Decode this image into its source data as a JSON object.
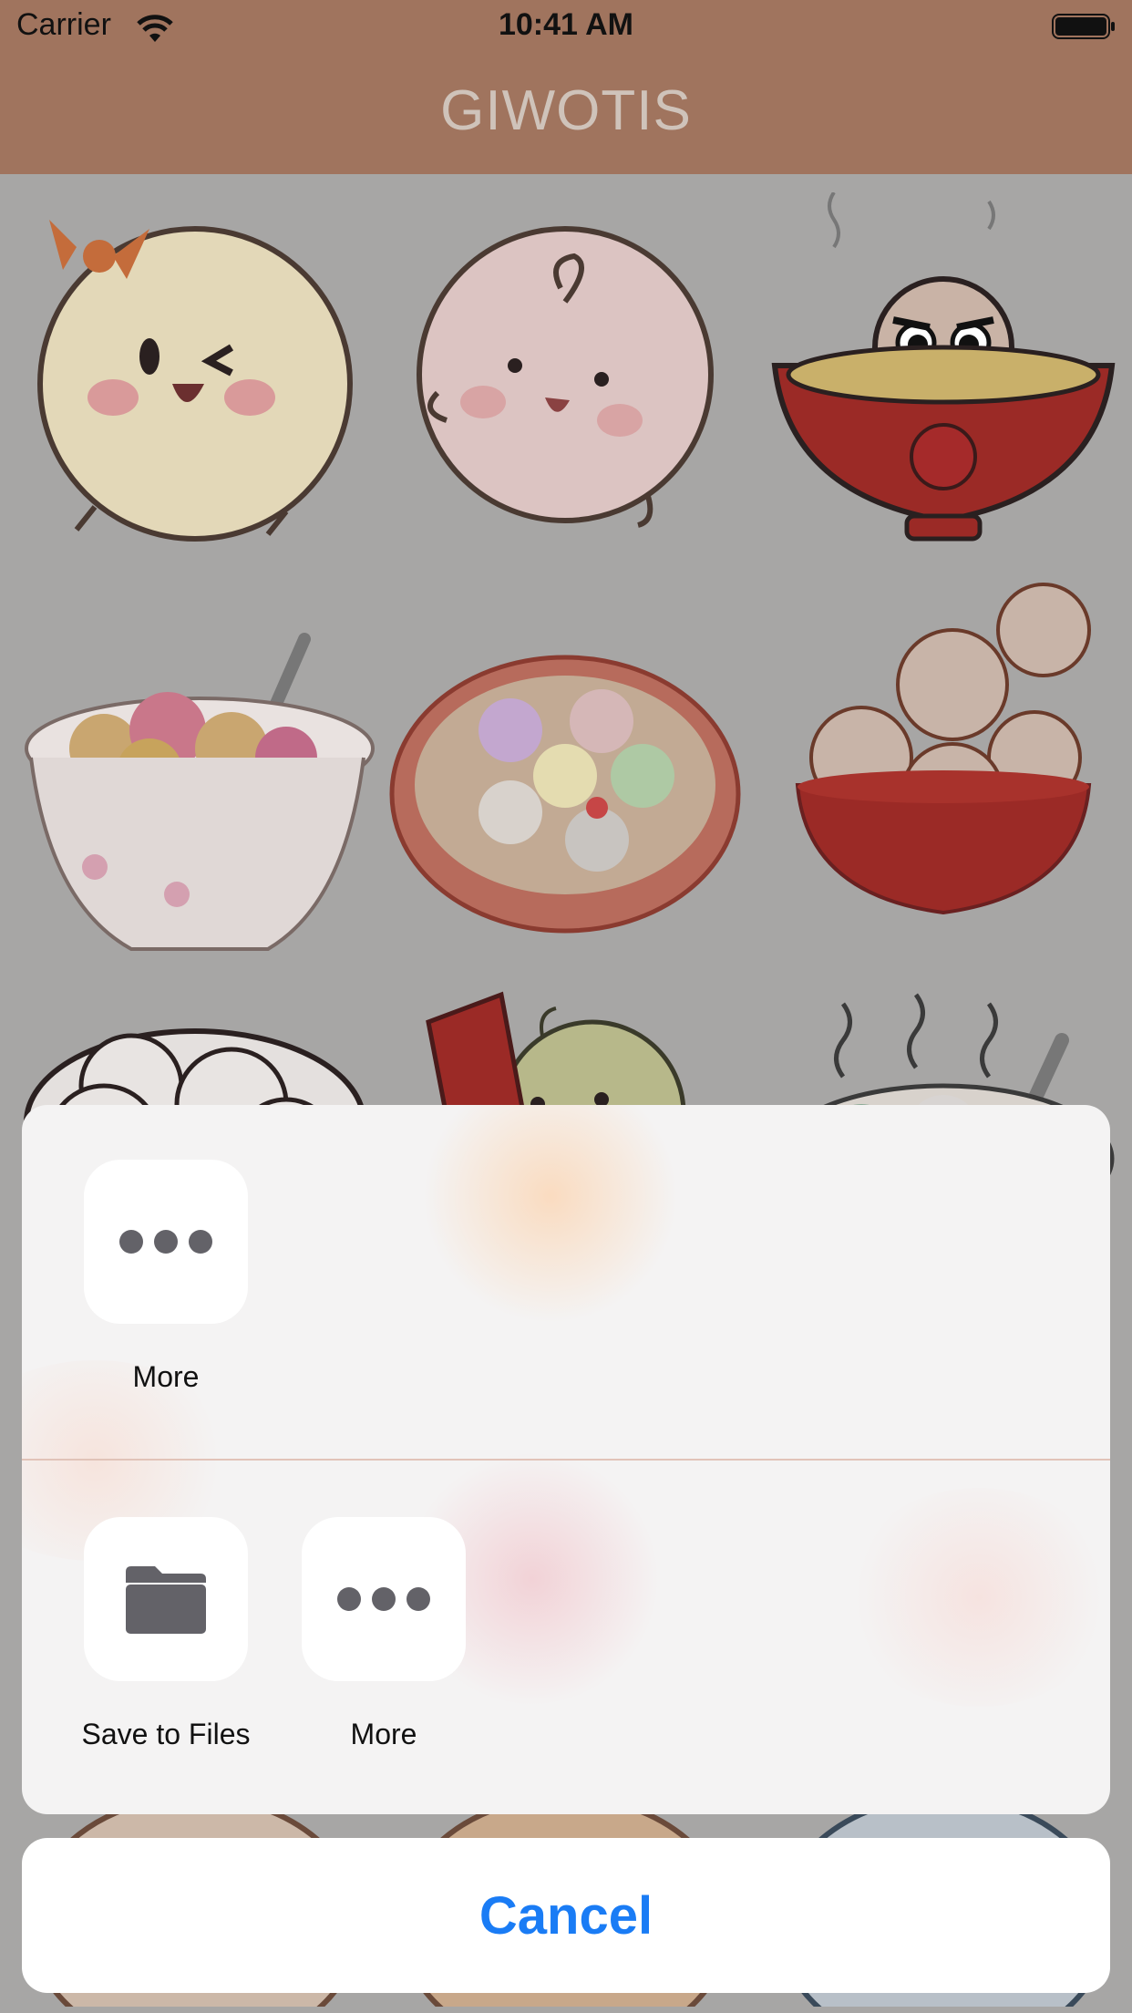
{
  "status_bar": {
    "carrier": "Carrier",
    "time": "10:41 AM"
  },
  "nav": {
    "title": "GIWOTIS"
  },
  "gallery": {
    "items": [
      {
        "name": "sticker-tangyuan-bow"
      },
      {
        "name": "sticker-tangyuan-swirl"
      },
      {
        "name": "sticker-tangyuan-bowl-fu"
      },
      {
        "name": "sticker-tangyuan-pastel-bowl"
      },
      {
        "name": "sticker-tangyuan-soup-bowl"
      },
      {
        "name": "sticker-tangyuan-red-bowl"
      },
      {
        "name": "sticker-tangyuan-pile"
      },
      {
        "name": "sticker-tangyuan-banner"
      },
      {
        "name": "sticker-tangyuan-steaming"
      }
    ]
  },
  "share_sheet": {
    "row1": [
      {
        "label": "More",
        "icon": "more-icon"
      }
    ],
    "row2": [
      {
        "label": "Save to Files",
        "icon": "folder-icon"
      },
      {
        "label": "More",
        "icon": "more-icon"
      }
    ],
    "cancel_label": "Cancel"
  },
  "colors": {
    "nav_bar": "#a0745e",
    "accent": "#1a7cf5",
    "icon_gray": "#636268"
  }
}
